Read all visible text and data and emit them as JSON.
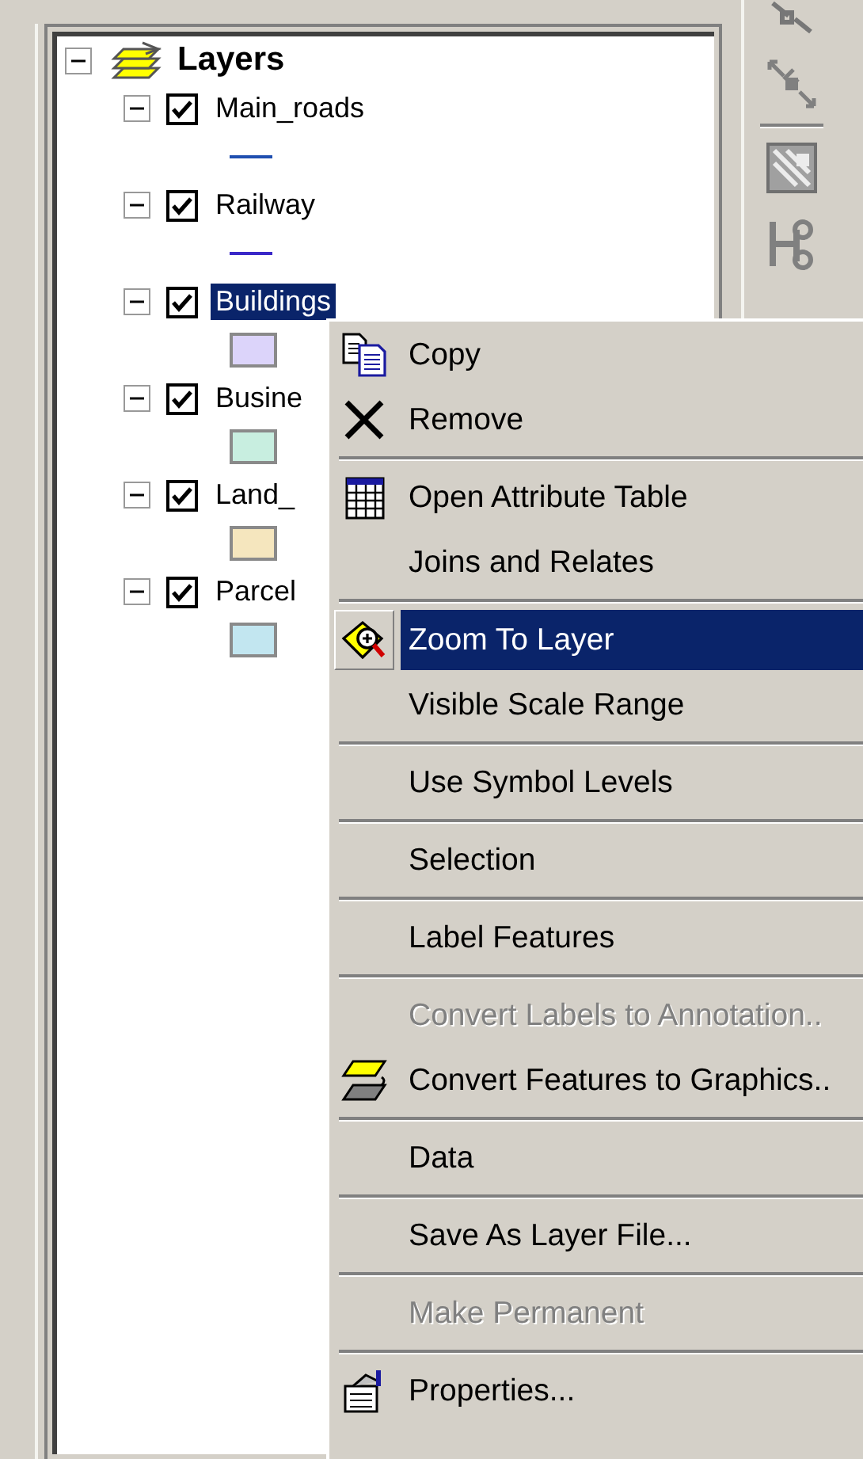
{
  "toc": {
    "root": {
      "label": "Layers",
      "expanded": true,
      "children": [
        {
          "label": "Main_roads",
          "checked": true,
          "expanded": true,
          "selected": false,
          "symbol": {
            "kind": "line",
            "color": "#1f4fb0"
          }
        },
        {
          "label": "Railway",
          "checked": true,
          "expanded": true,
          "selected": false,
          "symbol": {
            "kind": "line",
            "color": "#3a28c8"
          }
        },
        {
          "label": "Buildings",
          "checked": true,
          "expanded": true,
          "selected": true,
          "symbol": {
            "kind": "fill",
            "color": "#dcd4fa"
          }
        },
        {
          "label": "Busine",
          "checked": true,
          "expanded": true,
          "selected": false,
          "symbol": {
            "kind": "fill",
            "color": "#c8eee0"
          }
        },
        {
          "label": "Land_",
          "checked": true,
          "expanded": true,
          "selected": false,
          "symbol": {
            "kind": "fill",
            "color": "#f5e6be"
          }
        },
        {
          "label": "Parcel",
          "checked": true,
          "expanded": true,
          "selected": false,
          "symbol": {
            "kind": "fill",
            "color": "#c2e6f0"
          }
        }
      ]
    }
  },
  "context_menu": {
    "groups": [
      [
        {
          "label": "Copy",
          "kind": "copy",
          "disabled": false,
          "selected": false
        },
        {
          "label": "Remove",
          "kind": "remove",
          "disabled": false,
          "selected": false
        }
      ],
      [
        {
          "label": "Open Attribute Table",
          "kind": "table",
          "disabled": false,
          "selected": false
        },
        {
          "label": "Joins and Relates",
          "kind": "plain",
          "disabled": false,
          "selected": false
        }
      ],
      [
        {
          "label": "Zoom To Layer",
          "kind": "zoom",
          "disabled": false,
          "selected": true
        },
        {
          "label": "Visible Scale Range",
          "kind": "plain",
          "disabled": false,
          "selected": false
        }
      ],
      [
        {
          "label": "Use Symbol Levels",
          "kind": "plain",
          "disabled": false,
          "selected": false
        }
      ],
      [
        {
          "label": "Selection",
          "kind": "plain",
          "disabled": false,
          "selected": false
        }
      ],
      [
        {
          "label": "Label Features",
          "kind": "plain",
          "disabled": false,
          "selected": false
        }
      ],
      [
        {
          "label": "Convert Labels to Annotation..",
          "kind": "plain",
          "disabled": true,
          "selected": false
        },
        {
          "label": "Convert Features to Graphics..",
          "kind": "graphics",
          "disabled": false,
          "selected": false
        }
      ],
      [
        {
          "label": "Data",
          "kind": "plain",
          "disabled": false,
          "selected": false
        }
      ],
      [
        {
          "label": "Save As Layer File...",
          "kind": "plain",
          "disabled": false,
          "selected": false
        }
      ],
      [
        {
          "label": "Make Permanent",
          "kind": "plain",
          "disabled": true,
          "selected": false
        }
      ],
      [
        {
          "label": "Properties...",
          "kind": "properties",
          "disabled": false,
          "selected": false
        }
      ]
    ]
  }
}
